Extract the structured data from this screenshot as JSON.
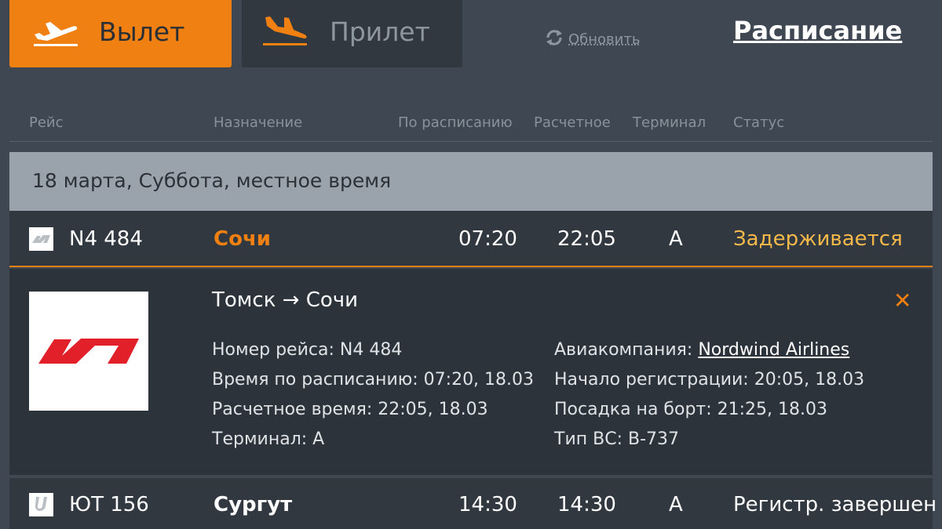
{
  "tabs": {
    "departures": {
      "label": "Вылет",
      "icon": "plane-takeoff-icon"
    },
    "arrivals": {
      "label": "Прилет",
      "icon": "plane-landing-icon"
    }
  },
  "refresh": {
    "label": "Обновить",
    "icon": "refresh-icon"
  },
  "schedule": {
    "label": "Расписание"
  },
  "columns": {
    "flight": "Рейс",
    "destination": "Назначение",
    "scheduled": "По расписанию",
    "estimated": "Расчетное",
    "terminal": "Терминал",
    "status": "Статус"
  },
  "date_bar": {
    "text": "18 марта, Суббота, местное время"
  },
  "flights": [
    {
      "number": "N4 484",
      "destination": "Сочи",
      "scheduled": "07:20",
      "estimated": "22:05",
      "terminal": "A",
      "status": "Задерживается",
      "status_color": "#f5b84a",
      "airline_icon": "nordwind-logo-icon"
    },
    {
      "number": "ЮТ 156",
      "destination": "Сургут",
      "scheduled": "14:30",
      "estimated": "14:30",
      "terminal": "A",
      "status": "Регистр. завершен",
      "airline_icon": "utair-logo-icon"
    }
  ],
  "detail": {
    "route": "Томск → Сочи",
    "close_icon": "close-icon",
    "flight_number": "Номер рейса: N4 484",
    "scheduled_time": "Время по расписанию: 07:20, 18.03",
    "estimated_time": "Расчетное время: 22:05, 18.03",
    "terminal": "Терминал: A",
    "airline_label": "Авиакомпания: ",
    "airline_name": "Nordwind Airlines",
    "checkin_start": "Начало регистрации: 20:05, 18.03",
    "boarding": "Посадка на борт: 21:25, 18.03",
    "aircraft_type": "Тип ВС: B-737"
  },
  "colors": {
    "accent": "#f08012",
    "background": "#3f4852",
    "row": "#313840",
    "panel": "#2c333b",
    "nordwind_red": "#e2202a"
  }
}
